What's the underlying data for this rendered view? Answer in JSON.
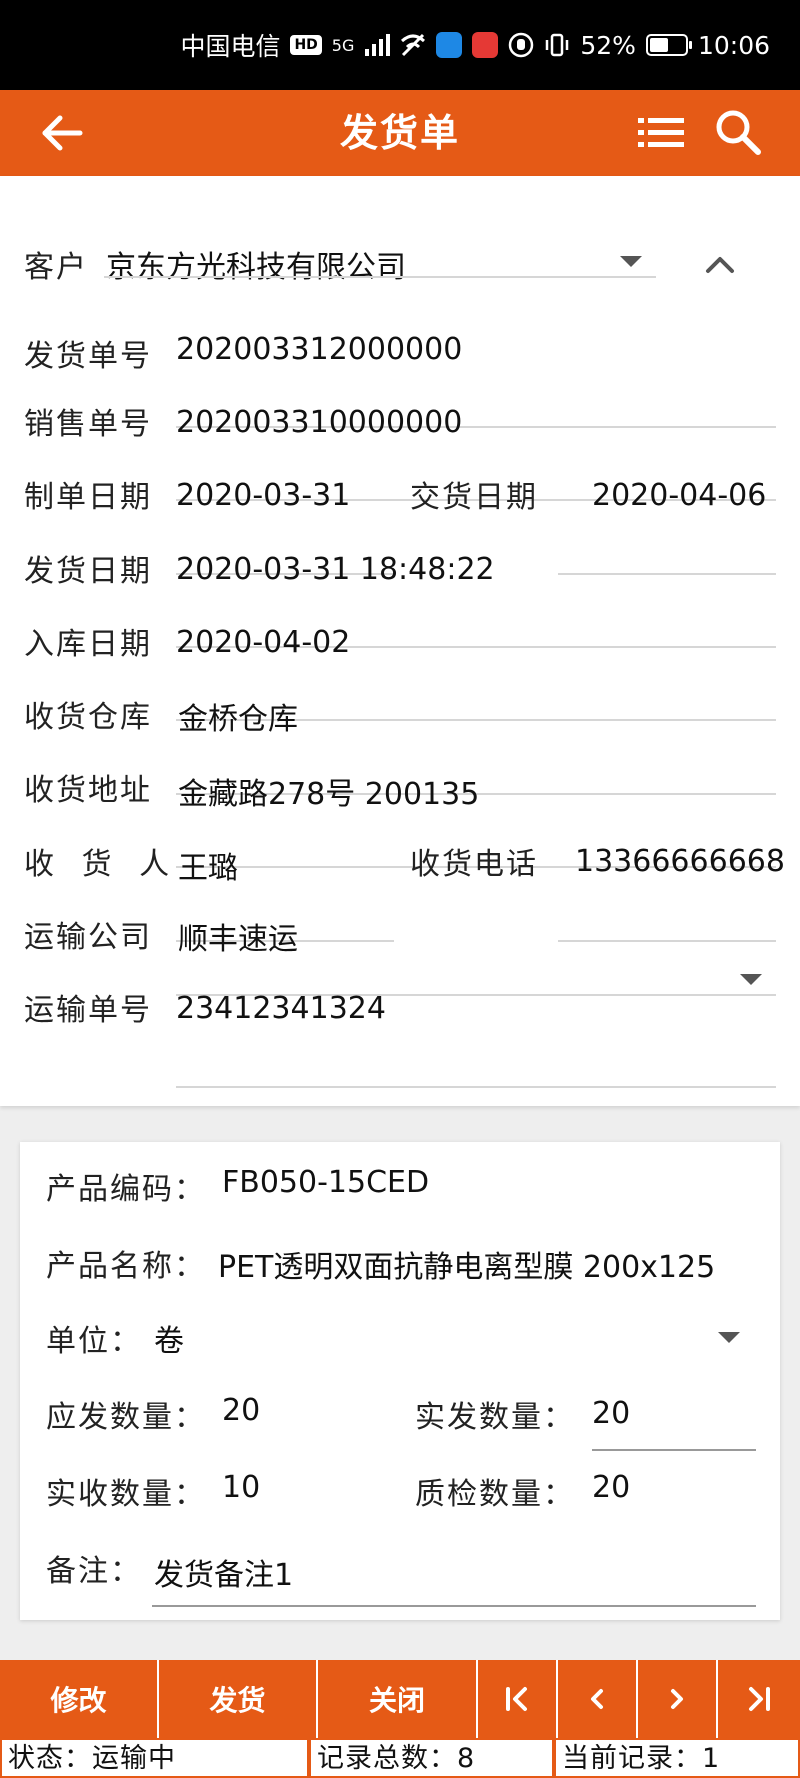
{
  "statusbar": {
    "carrier": "中国电信",
    "hd": "HD",
    "network": "5G",
    "battery_text": "52%",
    "battery_level": 0.52,
    "time": "10:06"
  },
  "header": {
    "title": "发货单"
  },
  "form": {
    "customer_label": "客户",
    "customer_value": "京东方光科技有限公司",
    "ship_no_label": "发货单号",
    "ship_no_value": "202003312000000",
    "sales_no_label": "销售单号",
    "sales_no_value": "202003310000000",
    "create_date_label": "制单日期",
    "create_date_value": "2020-03-31",
    "delivery_date_label": "交货日期",
    "delivery_date_value": "2020-04-06",
    "ship_date_label": "发货日期",
    "ship_date_value": "2020-03-31 18:48:22",
    "stock_date_label": "入库日期",
    "stock_date_value": "2020-04-02",
    "warehouse_label": "收货仓库",
    "warehouse_value": "金桥仓库",
    "address_label": "收货地址",
    "address_value": "金藏路278号 200135",
    "receiver_label": "收 货 人",
    "receiver_value": "王璐",
    "phone_label": "收货电话",
    "phone_value": "13366666668",
    "carrier_label": "运输公司",
    "carrier_value": "顺丰速运",
    "tracking_label": "运输单号",
    "tracking_value": "23412341324"
  },
  "product": {
    "code_label": "产品编码：",
    "code_value": "FB050-15CED",
    "name_label": "产品名称：",
    "name_value": "PET透明双面抗静电离型膜 200x125",
    "unit_label": "单位：",
    "unit_value": "卷",
    "due_qty_label": "应发数量：",
    "due_qty_value": "20",
    "actual_qty_label": "实发数量：",
    "actual_qty_value": "20",
    "received_qty_label": "实收数量：",
    "received_qty_value": "10",
    "qc_qty_label": "质检数量：",
    "qc_qty_value": "20",
    "remark_label": "备注：",
    "remark_value": "发货备注1"
  },
  "actions": {
    "edit": "修改",
    "ship": "发货",
    "close": "关闭"
  },
  "status_line": {
    "state": "状态：运输中",
    "total": "记录总数：8",
    "current": "当前记录：1"
  },
  "colors": {
    "accent": "#e55a16"
  },
  "icons": {
    "back": "arrow-left-icon",
    "menu": "list-icon",
    "search": "search-icon",
    "first": "first-page-icon",
    "prev": "chevron-left-icon",
    "next": "chevron-right-icon",
    "last": "last-page-icon"
  }
}
